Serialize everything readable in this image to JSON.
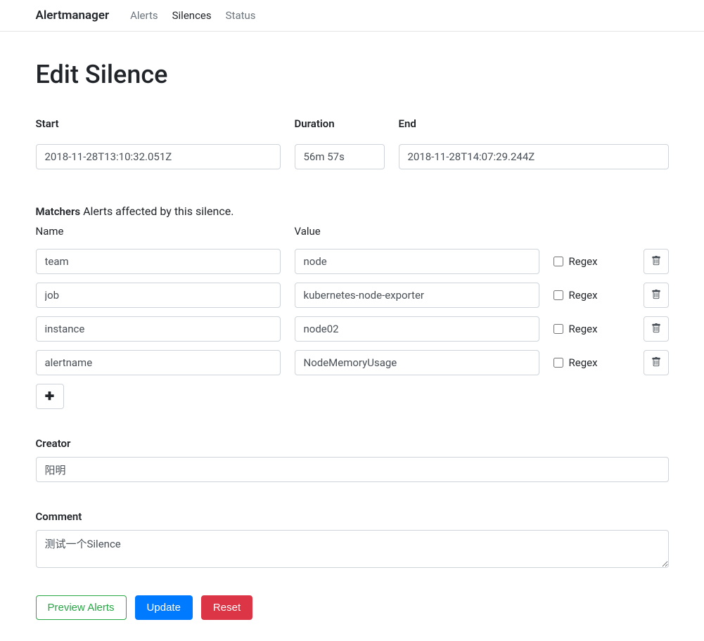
{
  "nav": {
    "brand": "Alertmanager",
    "links": [
      {
        "label": "Alerts",
        "active": false
      },
      {
        "label": "Silences",
        "active": true
      },
      {
        "label": "Status",
        "active": false
      }
    ]
  },
  "page_title": "Edit Silence",
  "time": {
    "start_label": "Start",
    "start_value": "2018-11-28T13:10:32.051Z",
    "duration_label": "Duration",
    "duration_value": "56m 57s",
    "end_label": "End",
    "end_value": "2018-11-28T14:07:29.244Z"
  },
  "matchers": {
    "heading": "Matchers",
    "subheading": "Alerts affected by this silence.",
    "name_header": "Name",
    "value_header": "Value",
    "regex_label": "Regex",
    "rows": [
      {
        "name": "team",
        "value": "node",
        "regex": false
      },
      {
        "name": "job",
        "value": "kubernetes-node-exporter",
        "regex": false
      },
      {
        "name": "instance",
        "value": "node02",
        "regex": false
      },
      {
        "name": "alertname",
        "value": "NodeMemoryUsage",
        "regex": false
      }
    ]
  },
  "creator": {
    "label": "Creator",
    "value": "阳明"
  },
  "comment": {
    "label": "Comment",
    "value": "测试一个Silence"
  },
  "buttons": {
    "preview": "Preview Alerts",
    "update": "Update",
    "reset": "Reset"
  }
}
